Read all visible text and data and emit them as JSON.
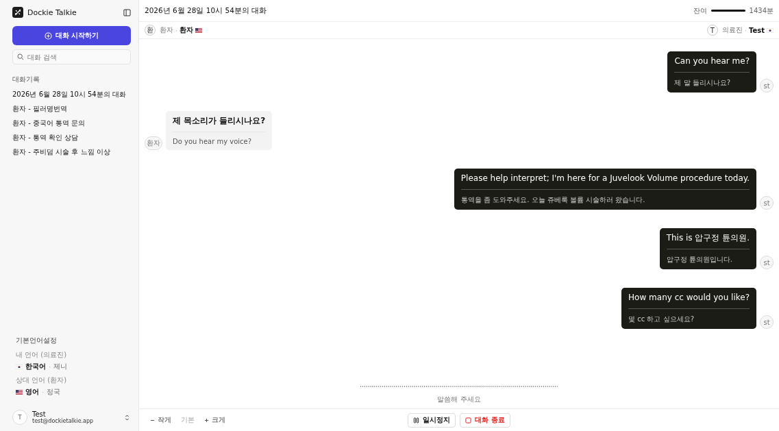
{
  "sidebar": {
    "app_name": "Dockie Talkie",
    "new_chat": "대화 시작하기",
    "search": {
      "placeholder": "대화 검색"
    },
    "history_title": "대화기록",
    "history": [
      {
        "title": "2026년 6월 28일 10시 54분의 대화"
      },
      {
        "title": "환자 - 필러명번역"
      },
      {
        "title": "환자 - 중국어 통역 문의"
      },
      {
        "title": "환자 - 통역 확인 상담"
      },
      {
        "title": "환자 - 주비덤 시술 후 느낌 이상"
      }
    ],
    "language_settings": {
      "title": "기본언어설정",
      "languages": [
        {
          "label": "내 언어 (의료진)",
          "kind": "kr",
          "language": "한국어",
          "separator": "·",
          "voice": "제니"
        },
        {
          "label": "상대 언어 (환자)",
          "kind": "us",
          "language": "영어",
          "separator": "·",
          "voice": "정국"
        }
      ]
    },
    "user": {
      "avatar": "T",
      "name": "Test",
      "email": "test@dockietalkie.app"
    }
  },
  "header": {
    "title": "2026년 6월 28일 10시 54분의 대화",
    "remaining_label": "잔여",
    "remaining": {
      "level": 1
    },
    "remaining_value": "1434분"
  },
  "participants": [
    {
      "avatar": "환",
      "role": "환자",
      "separator": "·",
      "name": "환자",
      "kind": "us"
    },
    {
      "avatar": "T",
      "role": "의료진",
      "separator": "·",
      "name": "Test",
      "kind": "kr"
    }
  ],
  "messages": [
    {
      "kind": "me",
      "text": "Can you hear me?",
      "translation": "제 말 들리시나요?",
      "avatar": "st"
    },
    {
      "kind": "other",
      "text": "제 목소리가 들리시나요?",
      "translation": "Do you hear my voice?",
      "avatar": "환자"
    },
    {
      "kind": "me",
      "text": "Please help interpret; I'm here for a Juvelook Volume procedure today.",
      "translation": "통역을 좀 도와주세요. 오늘 쥬베룩 볼륨 시술하러 왔습니다.",
      "avatar": "st"
    },
    {
      "kind": "me",
      "text": "This is 압구정 튠의원.",
      "translation": "압구정 튠의원입니다.",
      "avatar": "st"
    },
    {
      "kind": "me",
      "text": "How many cc would you like?",
      "translation": "몇 cc 하고 싶으세요?",
      "avatar": "st"
    }
  ],
  "listening_hint": "말씀해 주세요",
  "footer": {
    "smaller": "작게",
    "default": "기본",
    "larger": "크게",
    "pause": "일시정지",
    "end": "대화 종료"
  }
}
